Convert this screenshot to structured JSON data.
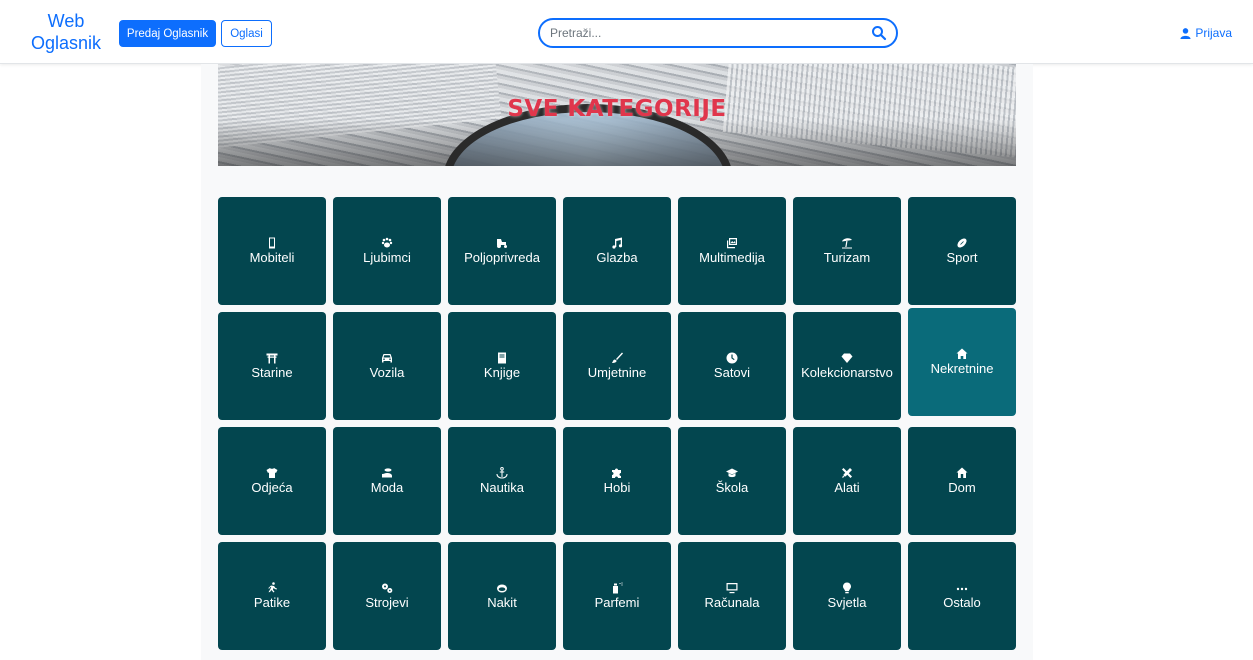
{
  "navbar": {
    "brand": "Web Oglasnik",
    "post_ad_label": "Predaj Oglasnik",
    "ads_label": "Oglasi",
    "search_placeholder": "Pretraži...",
    "login_label": "Prijava"
  },
  "banner": {
    "title": "SVE KATEGORIJE"
  },
  "categories": [
    {
      "label": "Mobiteli",
      "icon": "mobile-icon"
    },
    {
      "label": "Ljubimci",
      "icon": "paw-icon"
    },
    {
      "label": "Poljoprivreda",
      "icon": "tractor-icon"
    },
    {
      "label": "Glazba",
      "icon": "music-icon"
    },
    {
      "label": "Multimedija",
      "icon": "photo-film-icon"
    },
    {
      "label": "Turizam",
      "icon": "beach-umbrella-icon"
    },
    {
      "label": "Sport",
      "icon": "football-icon"
    },
    {
      "label": "Starine",
      "icon": "torii-gate-icon"
    },
    {
      "label": "Vozila",
      "icon": "car-icon"
    },
    {
      "label": "Knjige",
      "icon": "book-icon"
    },
    {
      "label": "Umjetnine",
      "icon": "paint-brush-icon"
    },
    {
      "label": "Satovi",
      "icon": "clock-icon"
    },
    {
      "label": "Kolekcionarstvo",
      "icon": "gem-icon"
    },
    {
      "label": "Nekretnine",
      "icon": "house-icon"
    },
    {
      "label": "Odjeća",
      "icon": "shirt-icon"
    },
    {
      "label": "Moda",
      "icon": "shoe-icon"
    },
    {
      "label": "Nautika",
      "icon": "anchor-icon"
    },
    {
      "label": "Hobi",
      "icon": "puzzle-icon"
    },
    {
      "label": "Škola",
      "icon": "graduation-cap-icon"
    },
    {
      "label": "Alati",
      "icon": "tools-icon"
    },
    {
      "label": "Dom",
      "icon": "home-icon"
    },
    {
      "label": "Patike",
      "icon": "running-icon"
    },
    {
      "label": "Strojevi",
      "icon": "gears-icon"
    },
    {
      "label": "Nakit",
      "icon": "ring-icon"
    },
    {
      "label": "Parfemi",
      "icon": "spray-can-icon"
    },
    {
      "label": "Računala",
      "icon": "computer-icon"
    },
    {
      "label": "Svjetla",
      "icon": "lightbulb-icon"
    },
    {
      "label": "Ostalo",
      "icon": "ellipsis-icon"
    }
  ],
  "colors": {
    "primary": "#0d6efd",
    "tile": "#03464f",
    "tile_active": "#0a6b7a",
    "banner_title": "#e0364c"
  }
}
